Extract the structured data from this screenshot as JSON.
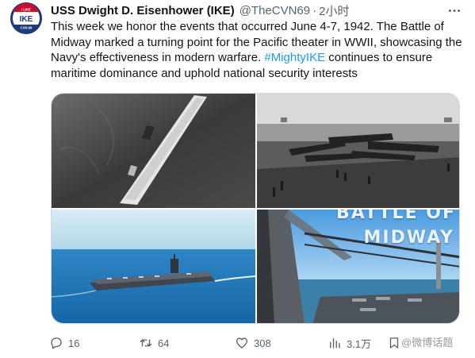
{
  "account": {
    "avatar_text_top": "I LIKE",
    "avatar_text_main": "IKE",
    "avatar_text_bottom": "CVN 69",
    "name": "USS Dwight D. Eisenhower (IKE)",
    "handle": "@TheCVN69",
    "separator": "·",
    "time": "2小时"
  },
  "tweet": {
    "text_before": "This week we honor the events that occurred June 4-7, 1942. The Battle of Midway marked a turning point for the Pacific theater in WWII, showcasing the Navy's effectiveness in modern warfare. ",
    "hashtag": "#MightyIKE",
    "text_after": " continues to ensure maritime dominance and uphold national security interests"
  },
  "media": {
    "image4_overlay_line1": "BATTLE OF",
    "image4_overlay_line2": "MIDWAY"
  },
  "actions": {
    "replies": "16",
    "retweets": "64",
    "likes": "308",
    "views": "3.1万"
  },
  "watermark": "@微博话题"
}
